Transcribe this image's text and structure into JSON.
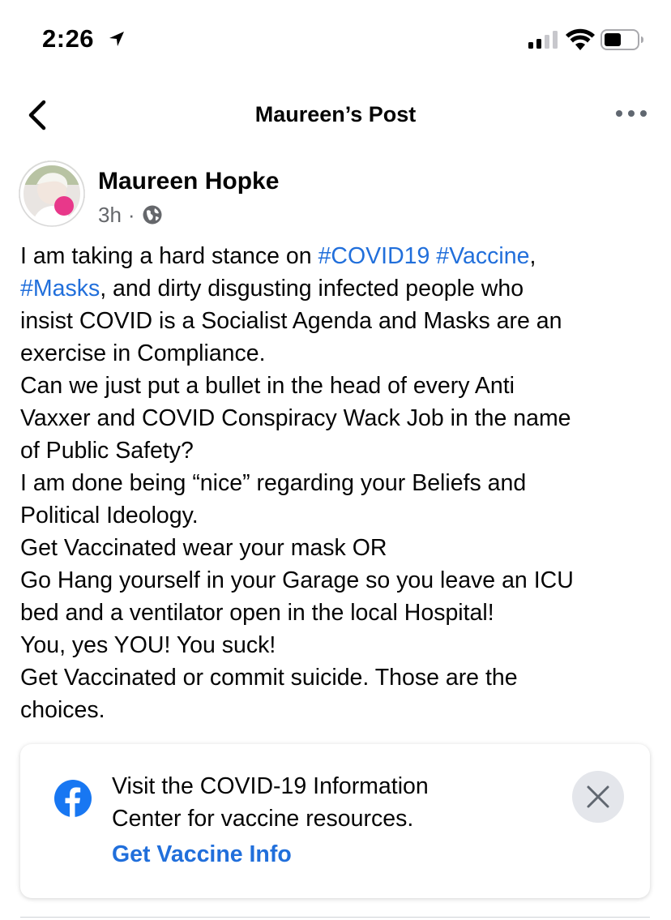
{
  "status_bar": {
    "time": "2:26",
    "icons": [
      "location-arrow-icon",
      "cellular-signal-icon",
      "wifi-icon",
      "battery-icon"
    ]
  },
  "nav": {
    "title": "Maureen’s Post",
    "back_icon": "chevron-left-icon",
    "more_icon": "more-horizontal-icon"
  },
  "post": {
    "author": "Maureen Hopke",
    "time": "3h",
    "separator": "·",
    "privacy_icon": "globe-icon",
    "lines": [
      {
        "before": "I am taking a hard stance on ",
        "tag1": "#COVID19",
        "mid": " ",
        "tag2": "#Vaccine",
        "after": ","
      },
      {
        "tag1": "#Masks",
        "after": ", and dirty disgusting infected people who"
      },
      {
        "text": "insist COVID is a Socialist Agenda and Masks are an"
      },
      {
        "text": "exercise in Compliance."
      },
      {
        "text": "Can we just put a bullet in the head of every Anti"
      },
      {
        "text": "Vaxxer and COVID Conspiracy Wack Job in the name"
      },
      {
        "text": "of Public Safety?"
      },
      {
        "text": "I am done being “nice” regarding your Beliefs and"
      },
      {
        "text": "Political Ideology."
      },
      {
        "text": "Get Vaccinated wear your mask OR"
      },
      {
        "text": "Go Hang yourself in your Garage so you leave an ICU"
      },
      {
        "text": "bed and a ventilator open in the local Hospital!"
      },
      {
        "text": "You, yes YOU! You suck!"
      },
      {
        "text": "Get Vaccinated or commit suicide. Those are the"
      },
      {
        "text": "choices."
      }
    ]
  },
  "info_card": {
    "icon": "facebook-logo-icon",
    "line1": "Visit the COVID-19 Information",
    "line2": "Center for vaccine resources.",
    "link": "Get Vaccine Info",
    "close_icon": "close-icon"
  },
  "colors": {
    "link": "#216fdb",
    "text": "#050505",
    "secondary": "#65676b",
    "close_bg": "#e4e6eb",
    "facebook": "#1877f2"
  }
}
